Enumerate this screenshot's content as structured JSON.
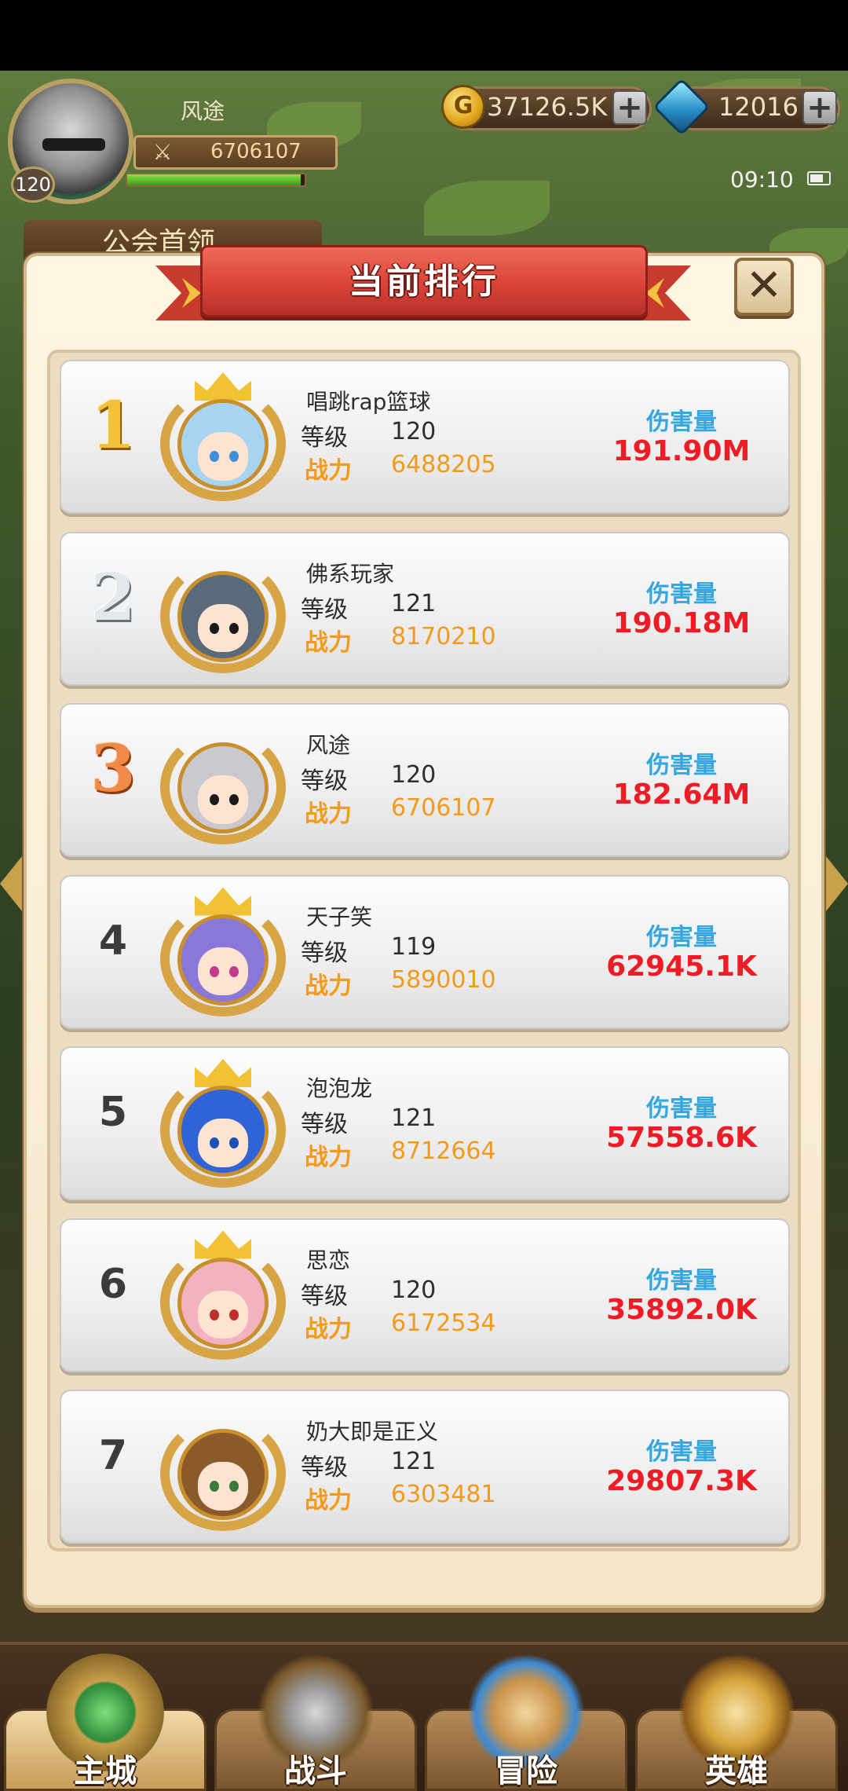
{
  "hud": {
    "player_name": "风途",
    "player_level": "120",
    "power": "6706107",
    "hp_fraction": 0.98,
    "gold": "37126.5K",
    "gems": "12016",
    "plus": "+",
    "clock": "09:10",
    "guild_tab": "公会首领",
    "coin_glyph": "G"
  },
  "dialog": {
    "title": "当前排行",
    "close_glyph": "✕"
  },
  "labels": {
    "level": "等级",
    "power": "战力",
    "damage": "伤害量"
  },
  "rankings": [
    {
      "rank": "1",
      "name": "唱跳rap篮球",
      "level": "120",
      "power": "6488205",
      "damage": "191.90M",
      "hair": "#a9d4f0",
      "eyes": "#3c8fd8",
      "crown": true
    },
    {
      "rank": "2",
      "name": "佛系玩家",
      "level": "121",
      "power": "8170210",
      "damage": "190.18M",
      "hair": "#5a6a7a",
      "eyes": "#1a1a1a",
      "crown": false
    },
    {
      "rank": "3",
      "name": "风途",
      "level": "120",
      "power": "6706107",
      "damage": "182.64M",
      "hair": "#c9c9cf",
      "eyes": "#1a1a1a",
      "crown": false
    },
    {
      "rank": "4",
      "name": "天子笑",
      "level": "119",
      "power": "5890010",
      "damage": "62945.1K",
      "hair": "#8a78d8",
      "eyes": "#c23a8a",
      "crown": true
    },
    {
      "rank": "5",
      "name": "泡泡龙",
      "level": "121",
      "power": "8712664",
      "damage": "57558.6K",
      "hair": "#2f63d6",
      "eyes": "#1d4fb8",
      "crown": true
    },
    {
      "rank": "6",
      "name": "思恋",
      "level": "120",
      "power": "6172534",
      "damage": "35892.0K",
      "hair": "#f2b2c0",
      "eyes": "#c0302a",
      "crown": true
    },
    {
      "rank": "7",
      "name": "奶大即是正义",
      "level": "121",
      "power": "6303481",
      "damage": "29807.3K",
      "hair": "#8a5a2a",
      "eyes": "#3a7a3a",
      "crown": false
    }
  ],
  "nav": [
    {
      "label": "主城",
      "icon": "castle-icon"
    },
    {
      "label": "战斗",
      "icon": "crossed-swords-icon"
    },
    {
      "label": "冒险",
      "icon": "scroll-map-icon"
    },
    {
      "label": "英雄",
      "icon": "hero-helmet-icon"
    }
  ],
  "colors": {
    "damage": "#ee1c25",
    "damage_label": "#36a6df",
    "power": "#f29a1c",
    "banner": "#d94437"
  }
}
